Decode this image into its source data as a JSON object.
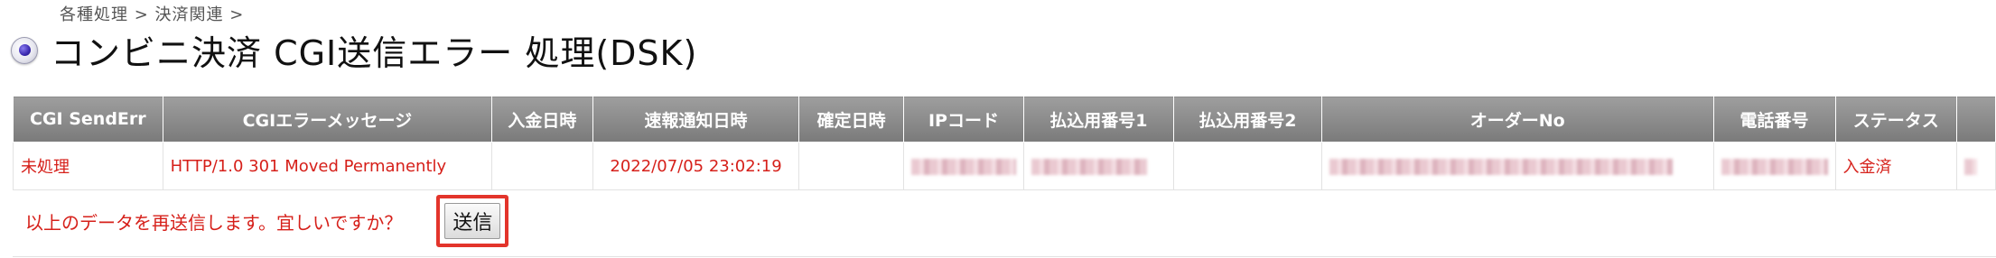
{
  "breadcrumb": "各種処理 > 決済関連 >",
  "page_title": "コンビニ決済 CGI送信エラー 処理(DSK)",
  "table": {
    "headers": [
      "CGI SendErr",
      "CGIエラーメッセージ",
      "入金日時",
      "速報通知日時",
      "確定日時",
      "IPコード",
      "払込用番号1",
      "払込用番号2",
      "オーダーNo",
      "電話番号",
      "ステータス",
      ""
    ],
    "rows": [
      {
        "cgi_senderr": "未処理",
        "cgi_error_message": "HTTP/1.0 301 Moved Permanently",
        "payment_datetime": "",
        "flash_notice_datetime": "2022/07/05 23:02:19",
        "confirmed_datetime": "",
        "status": "入金済"
      }
    ]
  },
  "confirm": {
    "message": "以上のデータを再送信します。宜しいですか？",
    "send_label": "送信"
  },
  "colors": {
    "error_text": "#d6201a",
    "header_bg": "#8a8a8a",
    "highlight": "#e3342b"
  }
}
